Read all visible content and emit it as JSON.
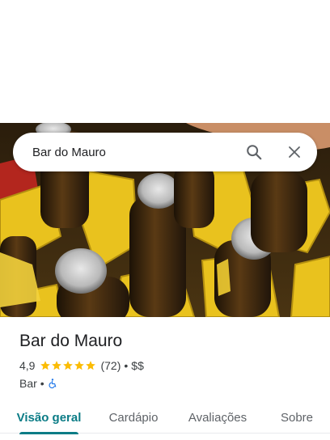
{
  "search": {
    "query": "Bar do Mauro",
    "search_icon": "search-icon",
    "close_icon": "close-icon"
  },
  "place": {
    "name": "Bar do Mauro",
    "rating": "4,9",
    "stars": 5,
    "reviews": "(72)",
    "price": "$$",
    "category": "Bar",
    "separator": "•",
    "accessibility_icon": "wheelchair-icon"
  },
  "tabs": [
    {
      "label": "Visão geral",
      "active": true
    },
    {
      "label": "Cardápio",
      "active": false
    },
    {
      "label": "Avaliações",
      "active": false
    },
    {
      "label": "Sobre",
      "active": false
    }
  ],
  "colors": {
    "accent": "#0b7c86",
    "star": "#fbbc04",
    "accessibility": "#1a73e8",
    "text": "#202124",
    "muted": "#5f6368"
  }
}
